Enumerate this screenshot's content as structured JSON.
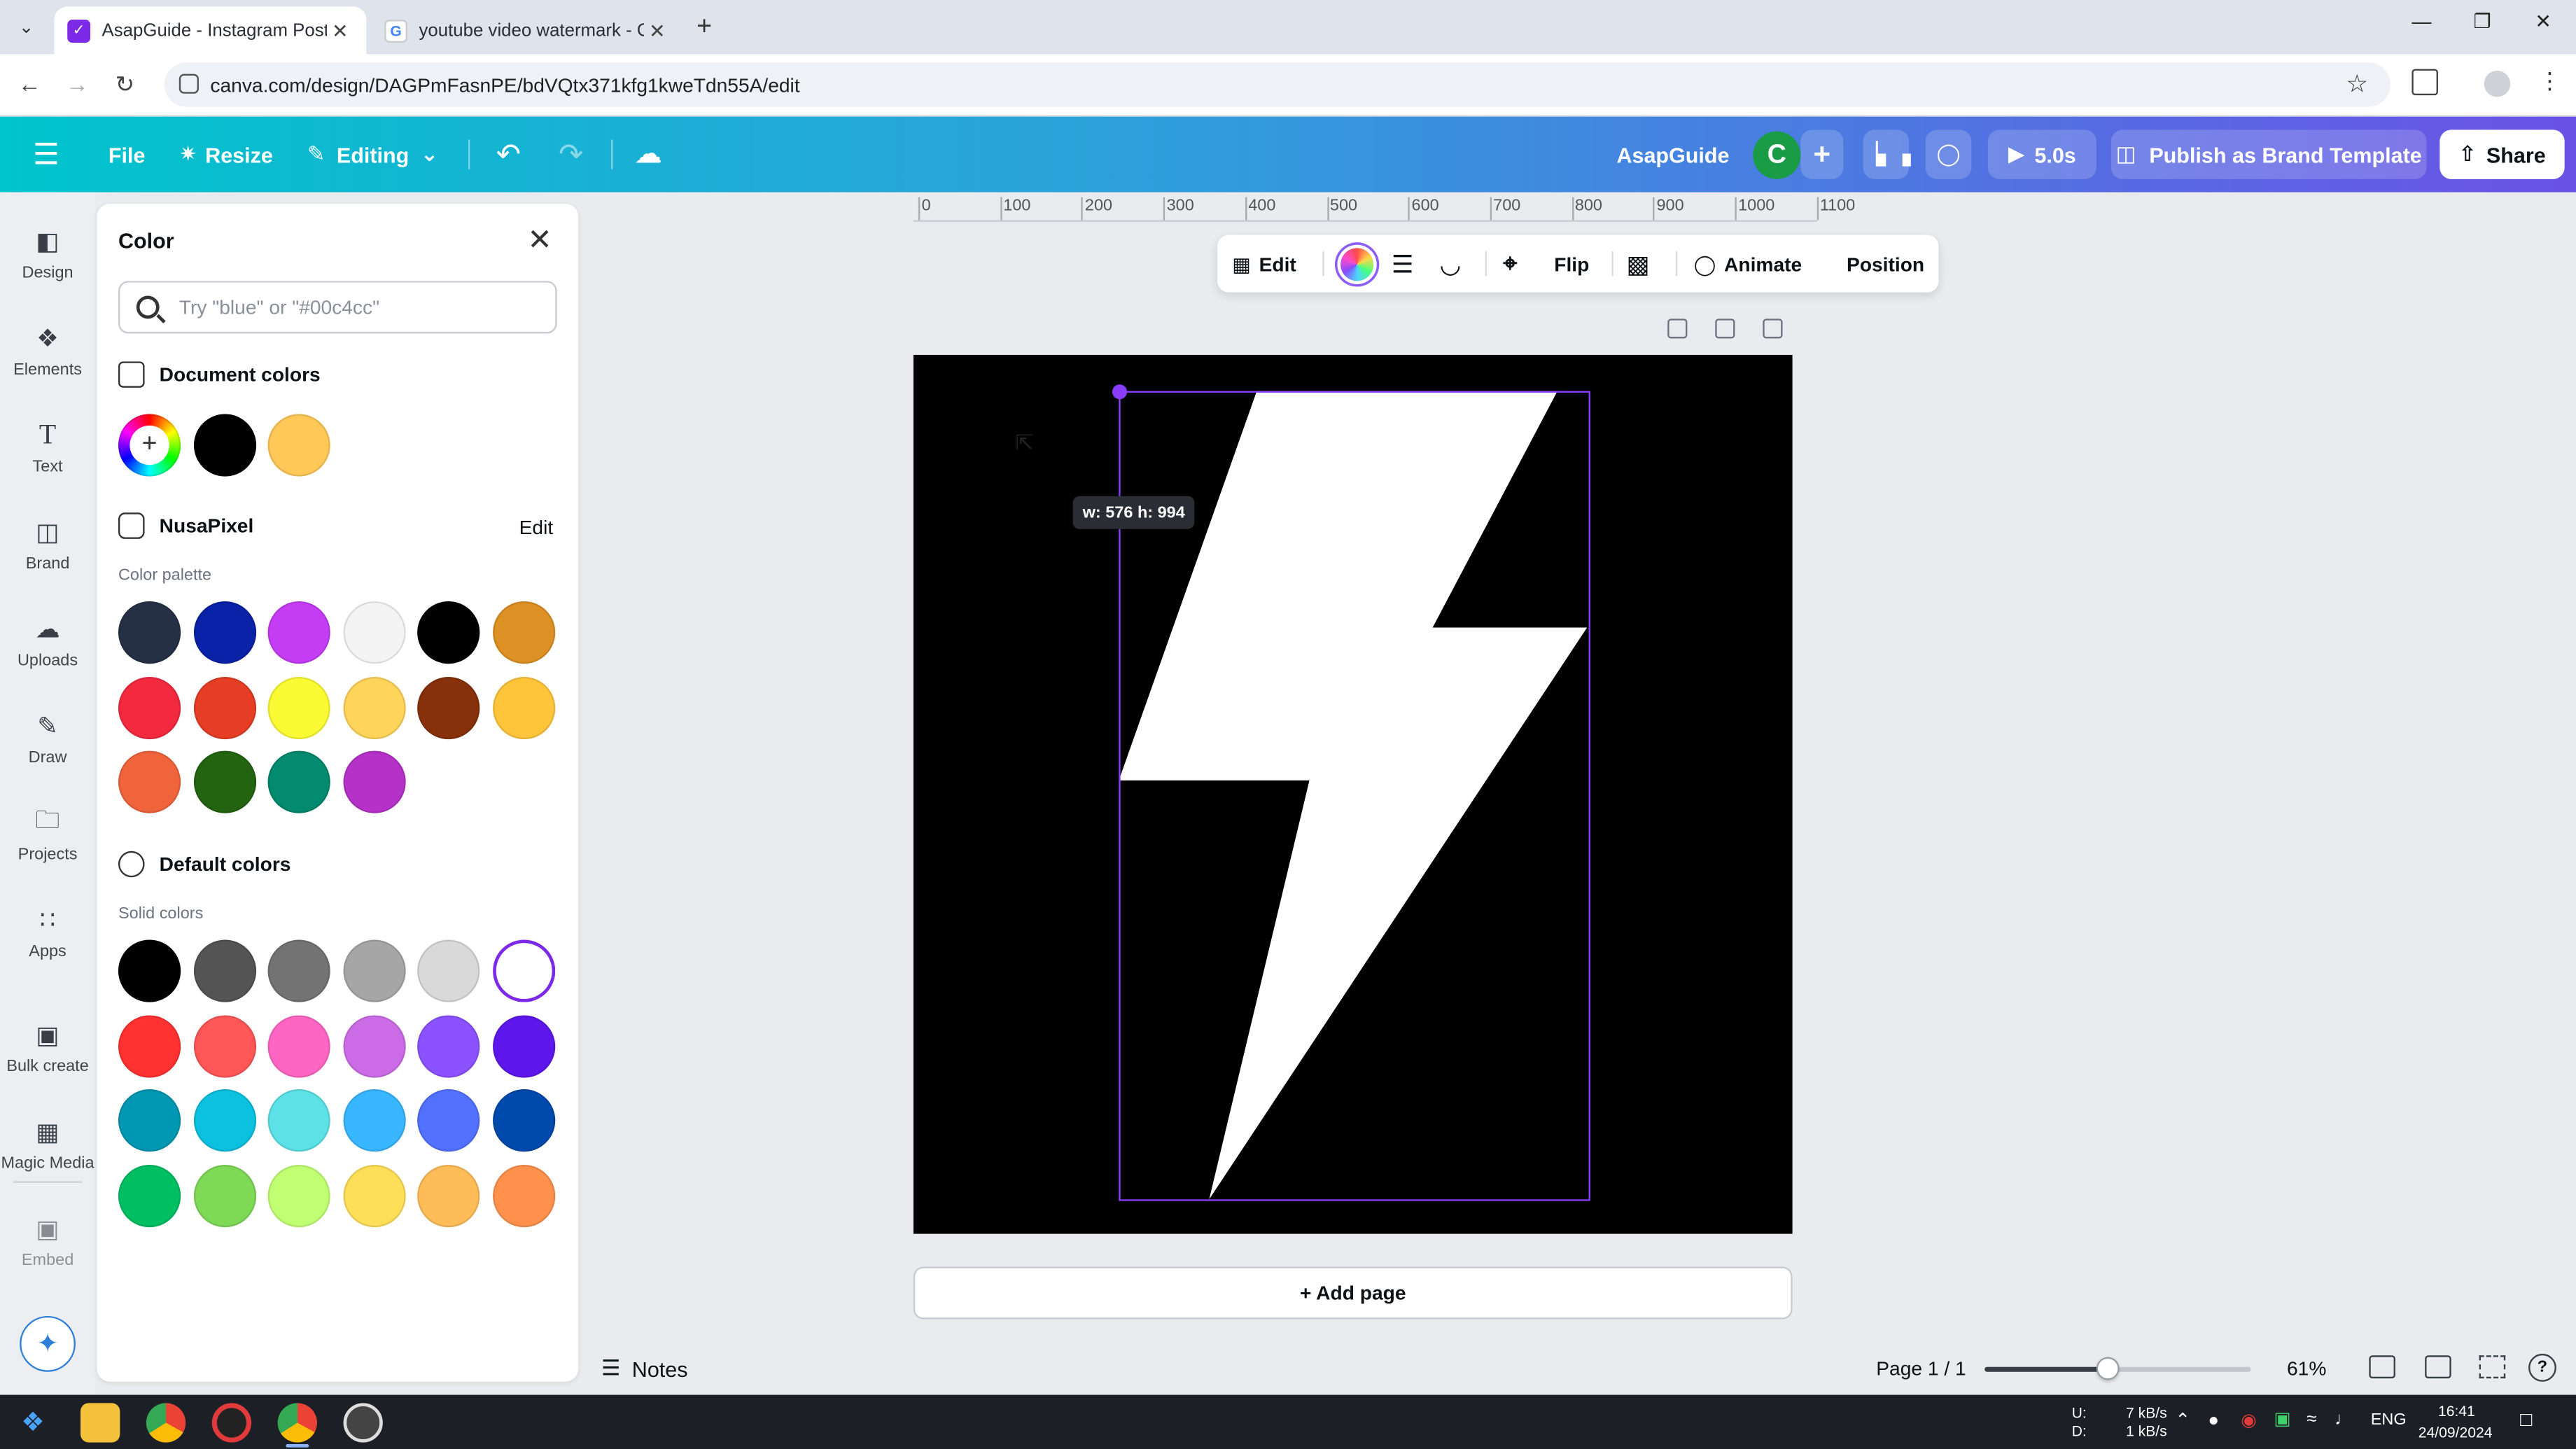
{
  "browser": {
    "tabs": [
      {
        "label": "AsapGuide - Instagram Post - C",
        "active": true
      },
      {
        "label": "youtube video watermark - Go",
        "active": false
      }
    ],
    "url": "canva.com/design/DAGPmFasnPE/bdVQtx371kfg1kweTdn55A/edit"
  },
  "header": {
    "file_label": "File",
    "resize_label": "Resize",
    "editing_label": "Editing",
    "design_name": "AsapGuide",
    "avatar_letter": "C",
    "play_label": "5.0s",
    "publish_label": "Publish as Brand Template",
    "share_label": "Share"
  },
  "rail": [
    {
      "label": "Design",
      "icon": "design-icon"
    },
    {
      "label": "Elements",
      "icon": "elements-icon"
    },
    {
      "label": "Text",
      "icon": "text-icon"
    },
    {
      "label": "Brand",
      "icon": "brand-icon"
    },
    {
      "label": "Uploads",
      "icon": "uploads-icon"
    },
    {
      "label": "Draw",
      "icon": "draw-icon"
    },
    {
      "label": "Projects",
      "icon": "projects-icon"
    },
    {
      "label": "Apps",
      "icon": "apps-icon"
    },
    {
      "label": "Bulk create",
      "icon": "bulk-create-icon"
    },
    {
      "label": "Magic Media",
      "icon": "magic-media-icon"
    },
    {
      "label": "Embed",
      "icon": "embed-icon"
    }
  ],
  "panel": {
    "title": "Color",
    "search_placeholder": "Try \"blue\" or \"#00c4cc\"",
    "document_colors_title": "Document colors",
    "document_colors": [
      "#000000",
      "#ffc857"
    ],
    "brand_kit_title": "NusaPixel",
    "brand_kit_edit": "Edit",
    "palette_label": "Color palette",
    "palette": [
      "#253045",
      "#0a22a8",
      "#c53cf5",
      "#f4f4f4",
      "#000000",
      "#dd9124",
      "#f2293f",
      "#e53e24",
      "#fafa34",
      "#ffd45a",
      "#87310c",
      "#ffc53a",
      "#f0643c",
      "#236410",
      "#048a6e",
      "#b531c8"
    ],
    "default_colors_title": "Default colors",
    "solid_label": "Solid colors",
    "solid_colors": [
      "#000000",
      "#545454",
      "#737373",
      "#a6a6a6",
      "#d9d9d9",
      "#ffffff",
      "#ff3131",
      "#ff5757",
      "#ff66c4",
      "#cb6ce6",
      "#8c52ff",
      "#5e17eb",
      "#0097b2",
      "#0cc0df",
      "#5ce1e6",
      "#38b6ff",
      "#5271ff",
      "#004aad",
      "#00bf63",
      "#7ed957",
      "#c1ff72",
      "#ffde59",
      "#ffbd59",
      "#ff914d"
    ],
    "selected_solid_index": 5
  },
  "canvas": {
    "ruler_ticks": [
      "0",
      "100",
      "200",
      "300",
      "400",
      "500",
      "600",
      "700",
      "800",
      "900",
      "1000",
      "1100"
    ],
    "toolbar": {
      "edit_label": "Edit",
      "flip_label": "Flip",
      "animate_label": "Animate",
      "position_label": "Position"
    },
    "size_tooltip": "w: 576 h: 994",
    "add_page_label": "+ Add page",
    "artboard_color": "#000000",
    "shape_color": "#ffffff",
    "selection_color": "#8b3dff"
  },
  "footer": {
    "notes_label": "Notes",
    "page_indicator": "Page 1 / 1",
    "zoom_value": "61%",
    "zoom_fraction": 0.46
  },
  "taskbar": {
    "network_up": "7 kB/s",
    "network_down": "1 kB/s",
    "net_label_up": "U:",
    "net_label_down": "D:",
    "language": "ENG",
    "time": "16:41",
    "date": "24/09/2024"
  },
  "colors": {
    "accent": "#8b3dff",
    "header_gradient_start": "#00c4cc",
    "header_gradient_end": "#6a52e6"
  }
}
